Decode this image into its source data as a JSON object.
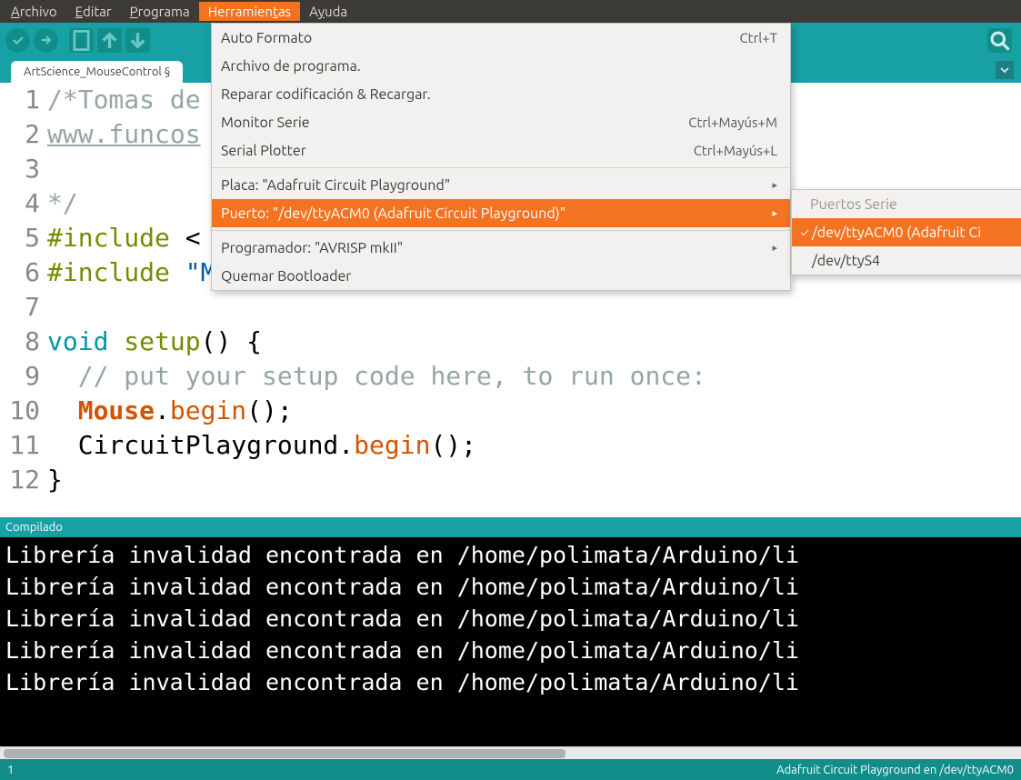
{
  "menubar": {
    "items": [
      {
        "label": "Archivo",
        "accel": "A"
      },
      {
        "label": "Editar",
        "accel": "E"
      },
      {
        "label": "Programa",
        "accel": "P"
      },
      {
        "label": "Herramientas",
        "accel": "t",
        "active": true
      },
      {
        "label": "Ayuda",
        "accel": "y"
      }
    ]
  },
  "toolbar": {
    "icons": [
      "verify",
      "upload",
      "new",
      "open",
      "save"
    ],
    "right_icon": "serial-monitor"
  },
  "tabs": {
    "active": "ArtScience_MouseControl §"
  },
  "editor": {
    "lines": [
      {
        "n": 1,
        "html": "<span class='c-comment'>/*Tomas de</span>"
      },
      {
        "n": 2,
        "html": "<span class='c-link'>www.funcos</span>"
      },
      {
        "n": 3,
        "html": ""
      },
      {
        "n": 4,
        "html": "<span class='c-comment'>*/</span>"
      },
      {
        "n": 5,
        "html": "<span class='c-pre'>#include</span> &lt;"
      },
      {
        "n": 6,
        "html": "<span class='c-pre'>#include</span> <span class='c-str'>\"Mouse.h\"</span>"
      },
      {
        "n": 7,
        "html": ""
      },
      {
        "n": 8,
        "html": "<span class='c-type'>void</span> <span class='c-kw'>setup</span>() {"
      },
      {
        "n": 9,
        "html": "  <span class='c-comment'>// put your setup code here, to run once:</span>"
      },
      {
        "n": 10,
        "html": "  <span class='c-obj'>Mouse</span>.<span class='c-begin'>begin</span>();"
      },
      {
        "n": 11,
        "html": "  CircuitPlayground.<span class='c-begin'>begin</span>();"
      },
      {
        "n": 12,
        "html": "}"
      }
    ]
  },
  "midbar": {
    "status": "Compilado"
  },
  "console": {
    "lines": [
      "Librería invalidad encontrada en /home/polimata/Arduino/li",
      "Librería invalidad encontrada en /home/polimata/Arduino/li",
      "Librería invalidad encontrada en /home/polimata/Arduino/li",
      "Librería invalidad encontrada en /home/polimata/Arduino/li",
      "Librería invalidad encontrada en /home/polimata/Arduino/li"
    ]
  },
  "statusbar": {
    "left": "1",
    "right": "Adafruit Circuit Playground en /dev/ttyACM0"
  },
  "dropdown": {
    "items": [
      {
        "type": "item",
        "label": "Auto Formato",
        "shortcut": "Ctrl+T"
      },
      {
        "type": "item",
        "label": "Archivo de programa."
      },
      {
        "type": "item",
        "label": "Reparar codificación & Recargar."
      },
      {
        "type": "item",
        "label": "Monitor Serie",
        "shortcut": "Ctrl+Mayús+M"
      },
      {
        "type": "item",
        "label": "Serial Plotter",
        "shortcut": "Ctrl+Mayús+L"
      },
      {
        "type": "sep"
      },
      {
        "type": "item",
        "label": "Placa: \"Adafruit Circuit Playground\"",
        "submenu": true
      },
      {
        "type": "item",
        "label": "Puerto: \"/dev/ttyACM0 (Adafruit Circuit Playground)\"",
        "submenu": true,
        "highlight": true
      },
      {
        "type": "sep"
      },
      {
        "type": "item",
        "label": "Programador: \"AVRISP mkII\"",
        "submenu": true
      },
      {
        "type": "item",
        "label": "Quemar Bootloader"
      }
    ]
  },
  "submenu": {
    "header": "Puertos Serie",
    "items": [
      {
        "label": "/dev/ttyACM0 (Adafruit Ci",
        "checked": true,
        "highlight": true
      },
      {
        "label": "/dev/ttyS4",
        "checked": false
      }
    ]
  }
}
